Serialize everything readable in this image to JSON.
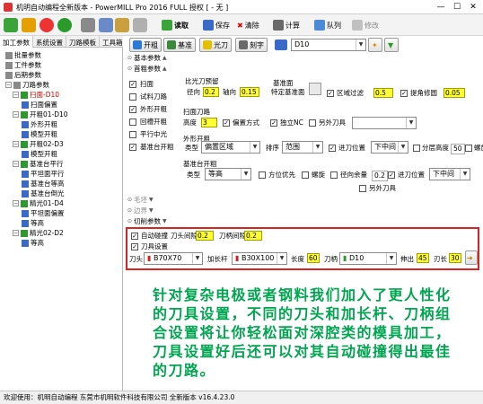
{
  "window": {
    "title": "机明自动编程全新版本 - PowerMILL Pro 2016 FULL 授权  [ - 无 ]",
    "controls": [
      "—",
      "☐",
      "✕"
    ]
  },
  "toolbar": {
    "read_label": "读取",
    "save_label": "保存",
    "delete_label": "清除",
    "calc_label": "计算",
    "queue_label": "队列",
    "modify_label": "修改"
  },
  "left_tabs": [
    "加工参数",
    "系统设置",
    "刀路模板",
    "工具箱"
  ],
  "tree": [
    {
      "label": "批量参数",
      "level": 1,
      "color": "#000"
    },
    {
      "label": "工件参数",
      "level": 1,
      "color": "#000"
    },
    {
      "label": "后期参数",
      "level": 1,
      "color": "#000"
    },
    {
      "label": "刀路参数",
      "level": 1,
      "color": "#000"
    },
    {
      "label": "扫面-D10",
      "level": 2,
      "color": "#d00000"
    },
    {
      "label": "扫面偏置",
      "level": 3,
      "color": "#000"
    },
    {
      "label": "开粗01-D10",
      "level": 2,
      "color": "#000"
    },
    {
      "label": "外形开粗",
      "level": 3,
      "color": "#000"
    },
    {
      "label": "模型开粗",
      "level": 3,
      "color": "#000"
    },
    {
      "label": "开粗02-D3",
      "level": 2,
      "color": "#000"
    },
    {
      "label": "模型开粗",
      "level": 3,
      "color": "#000"
    },
    {
      "label": "基准台平行",
      "level": 2,
      "color": "#000"
    },
    {
      "label": "平坦面平行",
      "level": 3,
      "color": "#000"
    },
    {
      "label": "基准台等高",
      "level": 3,
      "color": "#000"
    },
    {
      "label": "基准台倒光",
      "level": 3,
      "color": "#000"
    },
    {
      "label": "精光01-D4",
      "level": 2,
      "color": "#000"
    },
    {
      "label": "平坦面偏置",
      "level": 3,
      "color": "#000"
    },
    {
      "label": "等高",
      "level": 3,
      "color": "#000"
    },
    {
      "label": "精光02-D2",
      "level": 2,
      "color": "#000"
    },
    {
      "label": "等高",
      "level": 3,
      "color": "#000"
    }
  ],
  "right": {
    "open_rough_label": "开粗",
    "datum_label": "基准",
    "light_knife_label": "光刀",
    "engrave_label": "刻字",
    "tool_select": "D10",
    "basic_params": "基本参数",
    "first_rough_params": "首粗参数",
    "sweep_label": "扫面",
    "test_path_label": "试料刀路",
    "outer_rough_label": "外形开粗",
    "return_rough_label": "回槽开粗",
    "flat_light_label": "平行中光",
    "datum_rough_label": "基准台开粗",
    "ratio_label": "比光刀预留",
    "radial_label": "径向",
    "radial_value": "0.2",
    "axial_label": "轴向",
    "axial_value": "0.15",
    "datum_face_label": "基准面",
    "datum_face_sub": "特定基准面",
    "region_filter_label": "区域过滤",
    "region_filter_value": "0.5",
    "lift_label": "提角修圆",
    "lift_value": "0.05",
    "sweep_path_label": "扫面刀路",
    "height_label": "高度",
    "height_value": "3",
    "offset_label": "偏置方式",
    "independent_nc_label": "独立NC",
    "extra_tool_label": "另外刀具",
    "outer_rough_grp": "外形开粗",
    "type_label": "类型",
    "type_value": "偏置区域",
    "order_label": "排序",
    "order_value": "范围",
    "entry_label": "进刀位置",
    "entry_value": "下中间",
    "layer_height_label": "分层高度",
    "layer_height_value": "50",
    "spiral_label": "螺旋",
    "datum_rough_grp": "基准台开粗",
    "type2_label": "类型",
    "type2_value": "等高",
    "dir_opt_label": "方位优先",
    "spiral2_label": "螺旋",
    "radial_rest_label": "径向余量",
    "radial_rest_value": "0.2",
    "entry2_label": "进刀位置",
    "entry2_value": "下中间",
    "extra_tool2_label": "另外刀具",
    "light_knife_sect": "毛坯",
    "boundary_sect": "边界",
    "cut_params_sect": "切削参数",
    "auto_collision_label": "自动碰撞",
    "head_gap_label": "刀头间隙",
    "head_gap_value": "0.2",
    "shank_gap_label": "刀柄间隙",
    "shank_gap_value": "0.2",
    "tool_setting_label": "刀具设置",
    "head_label": "刀头",
    "head_value": "B70X70",
    "ext_label": "加长杆",
    "ext_value": "B30X100",
    "length_label": "长度",
    "length_value": "60",
    "holder_label": "刀柄",
    "holder_value": "D10",
    "stick_label": "伸出",
    "stick_value": "45",
    "blade_label": "刃长",
    "blade_value": "30"
  },
  "promo_text": "针对复杂电极或者钢料我们加入了更人性化的刀具设置，不同的刀头和加长杆、刀柄组合设置将让你轻松面对深腔类的模具加工，刀具设置好后还可以对其自动碰撞得出最佳的刀路。",
  "status": "欢迎使用：机明自动编程 东莞市机明软件科技有限公司 全新版本 v16.4.23.0",
  "colors": {
    "highlight": "#ffff33",
    "promo": "#00a550",
    "active_tree": "#d00000"
  }
}
